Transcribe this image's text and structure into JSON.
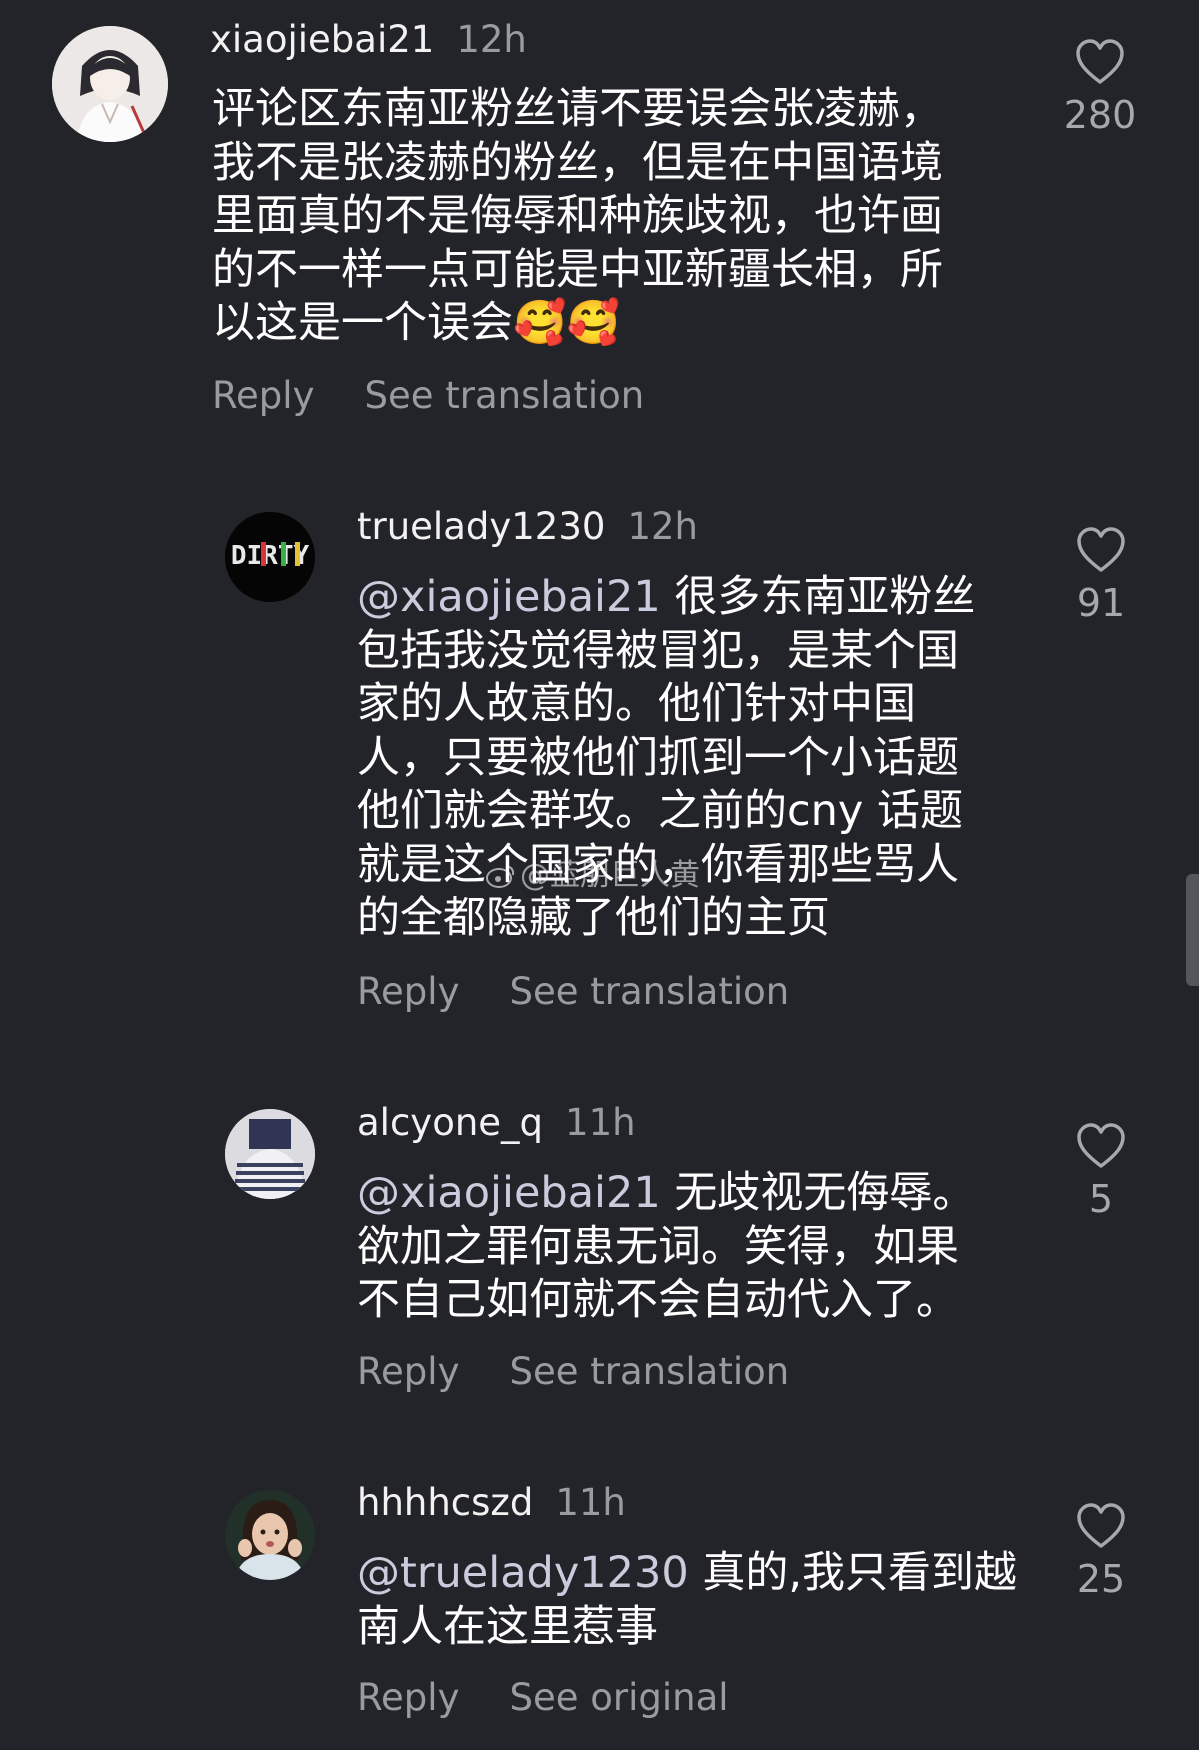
{
  "comments": [
    {
      "username": "xiaojiebai21",
      "time": "12h",
      "mention": "",
      "text": "评论区东南亚粉丝请不要误会张凌赫，\n我不是张凌赫的粉丝，但是在中国语境\n里面真的不是侮辱和种族歧视，也许画\n的不一样一点可能是中亚新疆长相，所\n以这是一个误会🥰🥰",
      "likes": "280",
      "action_reply": "Reply",
      "action_secondary": "See translation"
    },
    {
      "username": "truelady1230",
      "time": "12h",
      "mention": "@xiaojiebai21",
      "text": " 很多东南亚粉丝\n包括我没觉得被冒犯，是某个国\n家的人故意的。他们针对中国\n人，只要被他们抓到一个小话题\n他们就会群攻。之前的cny 话题\n就是这个国家的，你看那些骂人\n的全都隐藏了他们的主页",
      "likes": "91",
      "action_reply": "Reply",
      "action_secondary": "See translation",
      "avatar_text": "DIRTY"
    },
    {
      "username": "alcyone_q",
      "time": "11h",
      "mention": "@xiaojiebai21",
      "text": " 无歧视无侮辱。\n欲加之罪何患无词。笑得，如果\n不自己如何就不会自动代入了。",
      "likes": "5",
      "action_reply": "Reply",
      "action_secondary": "See translation"
    },
    {
      "username": "hhhhcszd",
      "time": "11h",
      "mention": "@truelady1230",
      "text": " 真的,我只看到越\n南人在这里惹事",
      "likes": "25",
      "action_reply": "Reply",
      "action_secondary": "See original"
    }
  ],
  "watermark": "@蓝朋巨人黄",
  "icons": {
    "like": "heart-outline-icon",
    "watermark_logo": "weibo-logo-icon"
  },
  "colors": {
    "background": "#232429",
    "secondary_text": "#9a9ba0"
  }
}
